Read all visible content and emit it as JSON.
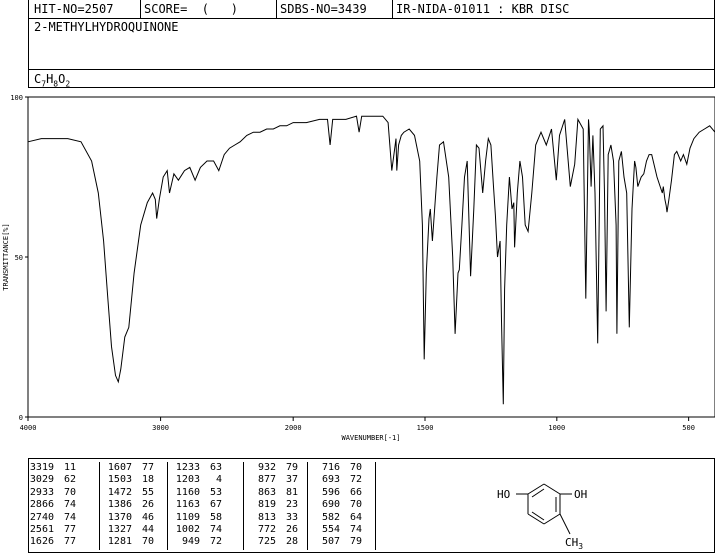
{
  "header": {
    "hit_no": "HIT-NO=2507",
    "score": "SCORE=  (   )",
    "sdbs_no": "SDBS-NO=3439",
    "ir_info": "IR-NIDA-01011 : KBR DISC"
  },
  "compound": {
    "name": "2-METHYLHYDROQUINONE",
    "formula_c": "C",
    "formula_c_sub": "7",
    "formula_h": "H",
    "formula_h_sub": "8",
    "formula_o": "O",
    "formula_o_sub": "2"
  },
  "chart_data": {
    "type": "line",
    "xlabel": "WAVENUMBER[-1]",
    "ylabel": "TRANSMITTANCE[%]",
    "xlim": [
      4000,
      400
    ],
    "ylim": [
      0,
      100
    ],
    "x_ticks": [
      4000,
      3000,
      2000,
      1500,
      1000,
      500
    ],
    "y_ticks": [
      0,
      50,
      100
    ],
    "grid": false,
    "series": [
      {
        "x": [
          4000,
          3900,
          3800,
          3700,
          3600,
          3520,
          3470,
          3430,
          3400,
          3370,
          3340,
          3319,
          3300,
          3270,
          3240,
          3200,
          3150,
          3100,
          3060,
          3040,
          3029,
          3010,
          2980,
          2950,
          2933,
          2900,
          2866,
          2820,
          2780,
          2740,
          2700,
          2650,
          2600,
          2561,
          2520,
          2480,
          2440,
          2400,
          2350,
          2300,
          2250,
          2200,
          2150,
          2100,
          2050,
          2000,
          1950,
          1900,
          1870,
          1860,
          1850,
          1800,
          1760,
          1750,
          1740,
          1700,
          1660,
          1640,
          1626,
          1610,
          1607,
          1600,
          1590,
          1580,
          1560,
          1540,
          1520,
          1510,
          1503,
          1495,
          1485,
          1480,
          1472,
          1465,
          1455,
          1445,
          1430,
          1410,
          1395,
          1386,
          1375,
          1370,
          1360,
          1350,
          1340,
          1327,
          1315,
          1305,
          1295,
          1281,
          1270,
          1260,
          1250,
          1240,
          1233,
          1225,
          1215,
          1210,
          1203,
          1198,
          1190,
          1180,
          1170,
          1163,
          1160,
          1150,
          1140,
          1130,
          1120,
          1109,
          1095,
          1080,
          1060,
          1040,
          1020,
          1002,
          990,
          970,
          949,
          932,
          920,
          900,
          890,
          880,
          877,
          870,
          866,
          863,
          855,
          845,
          835,
          825,
          819,
          813,
          805,
          795,
          785,
          775,
          772,
          765,
          755,
          745,
          735,
          725,
          715,
          705,
          700,
          693,
          680,
          670,
          660,
          650,
          640,
          620,
          600,
          596,
          590,
          585,
          582,
          575,
          565,
          554,
          545,
          530,
          520,
          507,
          495,
          480,
          460,
          440,
          420,
          400
        ],
        "y": [
          86,
          87,
          87,
          87,
          86,
          80,
          70,
          55,
          38,
          22,
          13,
          11,
          15,
          25,
          28,
          45,
          60,
          67,
          70,
          68,
          62,
          68,
          75,
          77,
          70,
          76,
          74,
          77,
          78,
          74,
          78,
          80,
          80,
          77,
          82,
          84,
          85,
          86,
          88,
          89,
          89,
          90,
          90,
          91,
          91,
          92,
          92,
          93,
          93,
          85,
          93,
          93,
          94,
          89,
          94,
          94,
          94,
          92,
          77,
          87,
          77,
          85,
          88,
          89,
          90,
          88,
          80,
          60,
          18,
          45,
          62,
          65,
          55,
          63,
          75,
          85,
          86,
          75,
          50,
          26,
          45,
          46,
          60,
          75,
          80,
          44,
          65,
          85,
          84,
          70,
          80,
          87,
          85,
          72,
          63,
          50,
          55,
          30,
          4,
          40,
          60,
          75,
          65,
          67,
          53,
          70,
          80,
          75,
          60,
          58,
          70,
          85,
          89,
          85,
          90,
          74,
          88,
          93,
          72,
          79,
          93,
          90,
          37,
          93,
          90,
          72,
          81,
          88,
          70,
          23,
          90,
          91,
          70,
          33,
          82,
          85,
          80,
          60,
          26,
          80,
          83,
          75,
          70,
          28,
          65,
          80,
          78,
          72,
          75,
          76,
          80,
          82,
          82,
          75,
          70,
          72,
          68,
          66,
          64,
          68,
          74,
          82,
          83,
          80,
          82,
          79,
          84,
          87,
          89,
          90,
          91,
          89
        ]
      }
    ]
  },
  "peaks": [
    {
      "w": "3319",
      "t": "11"
    },
    {
      "w": "3029",
      "t": "62"
    },
    {
      "w": "2933",
      "t": "70"
    },
    {
      "w": "2866",
      "t": "74"
    },
    {
      "w": "2740",
      "t": "74"
    },
    {
      "w": "2561",
      "t": "77"
    },
    {
      "w": "1626",
      "t": "77"
    },
    {
      "w": "1607",
      "t": "77"
    },
    {
      "w": "1503",
      "t": "18"
    },
    {
      "w": "1472",
      "t": "55"
    },
    {
      "w": "1386",
      "t": "26"
    },
    {
      "w": "1370",
      "t": "46"
    },
    {
      "w": "1327",
      "t": "44"
    },
    {
      "w": "1281",
      "t": "70"
    },
    {
      "w": "1233",
      "t": "63"
    },
    {
      "w": "1203",
      "t": "4"
    },
    {
      "w": "1160",
      "t": "53"
    },
    {
      "w": "1163",
      "t": "67"
    },
    {
      "w": "1109",
      "t": "58"
    },
    {
      "w": "1002",
      "t": "74"
    },
    {
      "w": "949",
      "t": "72"
    },
    {
      "w": "932",
      "t": "79"
    },
    {
      "w": "877",
      "t": "37"
    },
    {
      "w": "863",
      "t": "81"
    },
    {
      "w": "819",
      "t": "23"
    },
    {
      "w": "813",
      "t": "33"
    },
    {
      "w": "772",
      "t": "26"
    },
    {
      "w": "725",
      "t": "28"
    },
    {
      "w": "716",
      "t": "70"
    },
    {
      "w": "693",
      "t": "72"
    },
    {
      "w": "596",
      "t": "66"
    },
    {
      "w": "690",
      "t": "70"
    },
    {
      "w": "582",
      "t": "64"
    },
    {
      "w": "554",
      "t": "74"
    },
    {
      "w": "507",
      "t": "79"
    }
  ],
  "structure": {
    "left_group": "HO",
    "right_group": "OH",
    "methyl_c": "CH",
    "methyl_sub": "3"
  }
}
